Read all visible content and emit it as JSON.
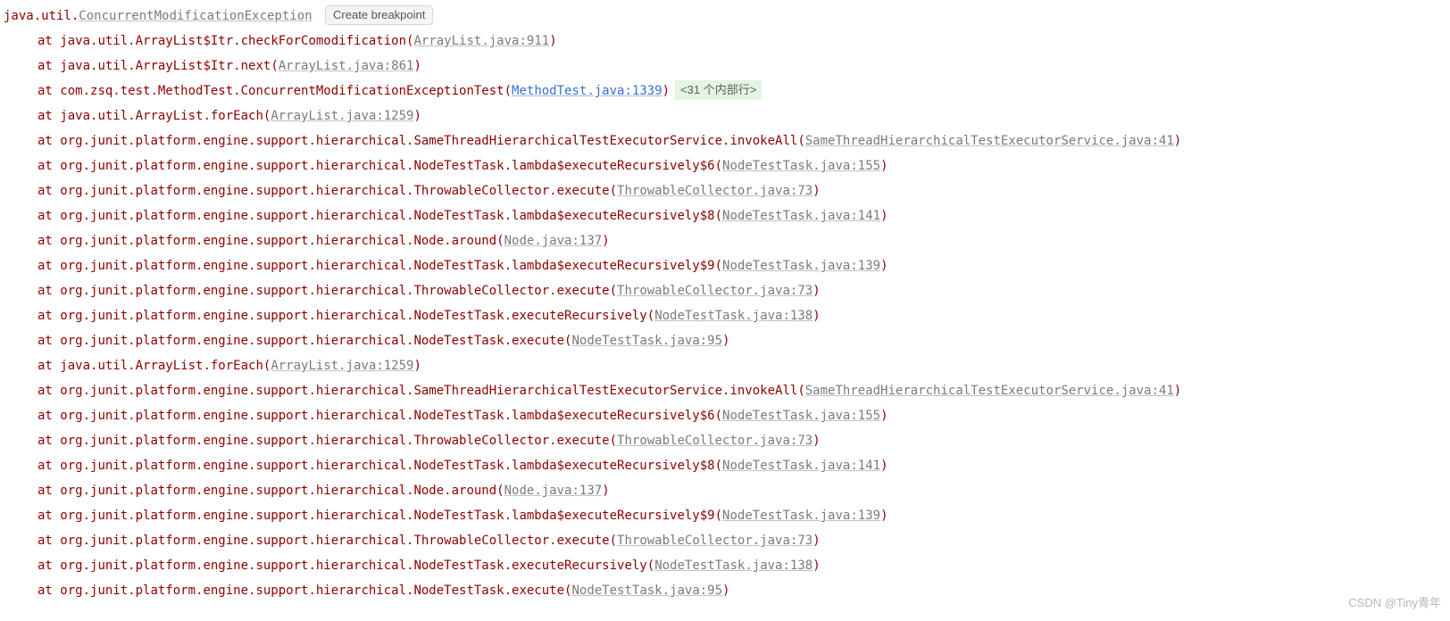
{
  "exception": {
    "package": "java.util.",
    "class": "ConcurrentModificationException",
    "breakpoint_label": "Create breakpoint"
  },
  "at_label": "at",
  "internal_badge": "<31 个内部行>",
  "watermark": "CSDN @Tiny青年",
  "frames": [
    {
      "method": "java.util.ArrayList$Itr.checkForComodification",
      "file": "ArrayList.java:911",
      "blue": false,
      "badge": false
    },
    {
      "method": "java.util.ArrayList$Itr.next",
      "file": "ArrayList.java:861",
      "blue": false,
      "badge": false
    },
    {
      "method": "com.zsq.test.MethodTest.ConcurrentModificationExceptionTest",
      "file": "MethodTest.java:1339",
      "blue": true,
      "badge": true
    },
    {
      "method": "java.util.ArrayList.forEach",
      "file": "ArrayList.java:1259",
      "blue": false,
      "badge": false
    },
    {
      "method": "org.junit.platform.engine.support.hierarchical.SameThreadHierarchicalTestExecutorService.invokeAll",
      "file": "SameThreadHierarchicalTestExecutorService.java:41",
      "blue": false,
      "badge": false
    },
    {
      "method": "org.junit.platform.engine.support.hierarchical.NodeTestTask.lambda$executeRecursively$6",
      "file": "NodeTestTask.java:155",
      "blue": false,
      "badge": false
    },
    {
      "method": "org.junit.platform.engine.support.hierarchical.ThrowableCollector.execute",
      "file": "ThrowableCollector.java:73",
      "blue": false,
      "badge": false
    },
    {
      "method": "org.junit.platform.engine.support.hierarchical.NodeTestTask.lambda$executeRecursively$8",
      "file": "NodeTestTask.java:141",
      "blue": false,
      "badge": false
    },
    {
      "method": "org.junit.platform.engine.support.hierarchical.Node.around",
      "file": "Node.java:137",
      "blue": false,
      "badge": false
    },
    {
      "method": "org.junit.platform.engine.support.hierarchical.NodeTestTask.lambda$executeRecursively$9",
      "file": "NodeTestTask.java:139",
      "blue": false,
      "badge": false
    },
    {
      "method": "org.junit.platform.engine.support.hierarchical.ThrowableCollector.execute",
      "file": "ThrowableCollector.java:73",
      "blue": false,
      "badge": false
    },
    {
      "method": "org.junit.platform.engine.support.hierarchical.NodeTestTask.executeRecursively",
      "file": "NodeTestTask.java:138",
      "blue": false,
      "badge": false
    },
    {
      "method": "org.junit.platform.engine.support.hierarchical.NodeTestTask.execute",
      "file": "NodeTestTask.java:95",
      "blue": false,
      "badge": false
    },
    {
      "method": "java.util.ArrayList.forEach",
      "file": "ArrayList.java:1259",
      "blue": false,
      "badge": false
    },
    {
      "method": "org.junit.platform.engine.support.hierarchical.SameThreadHierarchicalTestExecutorService.invokeAll",
      "file": "SameThreadHierarchicalTestExecutorService.java:41",
      "blue": false,
      "badge": false
    },
    {
      "method": "org.junit.platform.engine.support.hierarchical.NodeTestTask.lambda$executeRecursively$6",
      "file": "NodeTestTask.java:155",
      "blue": false,
      "badge": false
    },
    {
      "method": "org.junit.platform.engine.support.hierarchical.ThrowableCollector.execute",
      "file": "ThrowableCollector.java:73",
      "blue": false,
      "badge": false
    },
    {
      "method": "org.junit.platform.engine.support.hierarchical.NodeTestTask.lambda$executeRecursively$8",
      "file": "NodeTestTask.java:141",
      "blue": false,
      "badge": false
    },
    {
      "method": "org.junit.platform.engine.support.hierarchical.Node.around",
      "file": "Node.java:137",
      "blue": false,
      "badge": false
    },
    {
      "method": "org.junit.platform.engine.support.hierarchical.NodeTestTask.lambda$executeRecursively$9",
      "file": "NodeTestTask.java:139",
      "blue": false,
      "badge": false
    },
    {
      "method": "org.junit.platform.engine.support.hierarchical.ThrowableCollector.execute",
      "file": "ThrowableCollector.java:73",
      "blue": false,
      "badge": false
    },
    {
      "method": "org.junit.platform.engine.support.hierarchical.NodeTestTask.executeRecursively",
      "file": "NodeTestTask.java:138",
      "blue": false,
      "badge": false
    },
    {
      "method": "org.junit.platform.engine.support.hierarchical.NodeTestTask.execute",
      "file": "NodeTestTask.java:95",
      "blue": false,
      "badge": false
    }
  ]
}
